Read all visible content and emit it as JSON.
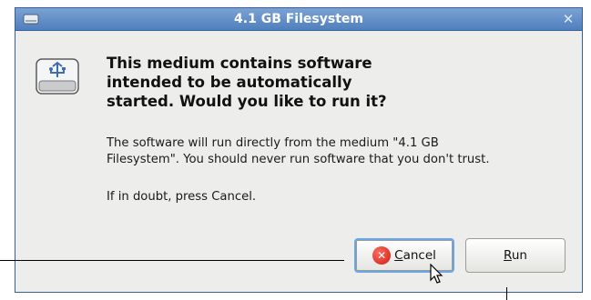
{
  "window": {
    "title": "4.1 GB Filesystem",
    "close_glyph": "✕"
  },
  "dialog": {
    "heading_line1": "This medium contains software",
    "heading_line2": "intended to be automatically",
    "heading_line3": "started. Would you like to run it?",
    "body_line1": "The software will run directly from the medium \"4.1 GB",
    "body_line2": "Filesystem\". You should never run software that you don't trust.",
    "doubt": "If in doubt, press Cancel."
  },
  "buttons": {
    "cancel_mnemonic": "C",
    "cancel_rest": "ancel",
    "run_mnemonic": "R",
    "run_rest": "un"
  },
  "icons": {
    "title": "usb-drive-icon",
    "drive": "usb-drive-icon",
    "cancel": "cancel-icon",
    "close": "close-icon",
    "cursor": "mouse-pointer-icon"
  },
  "colors": {
    "titlebar": "#5b8ac6",
    "dialog_bg": "#ededeb",
    "focus_ring": "#6aa6e6",
    "cancel_icon": "#e0281b"
  }
}
